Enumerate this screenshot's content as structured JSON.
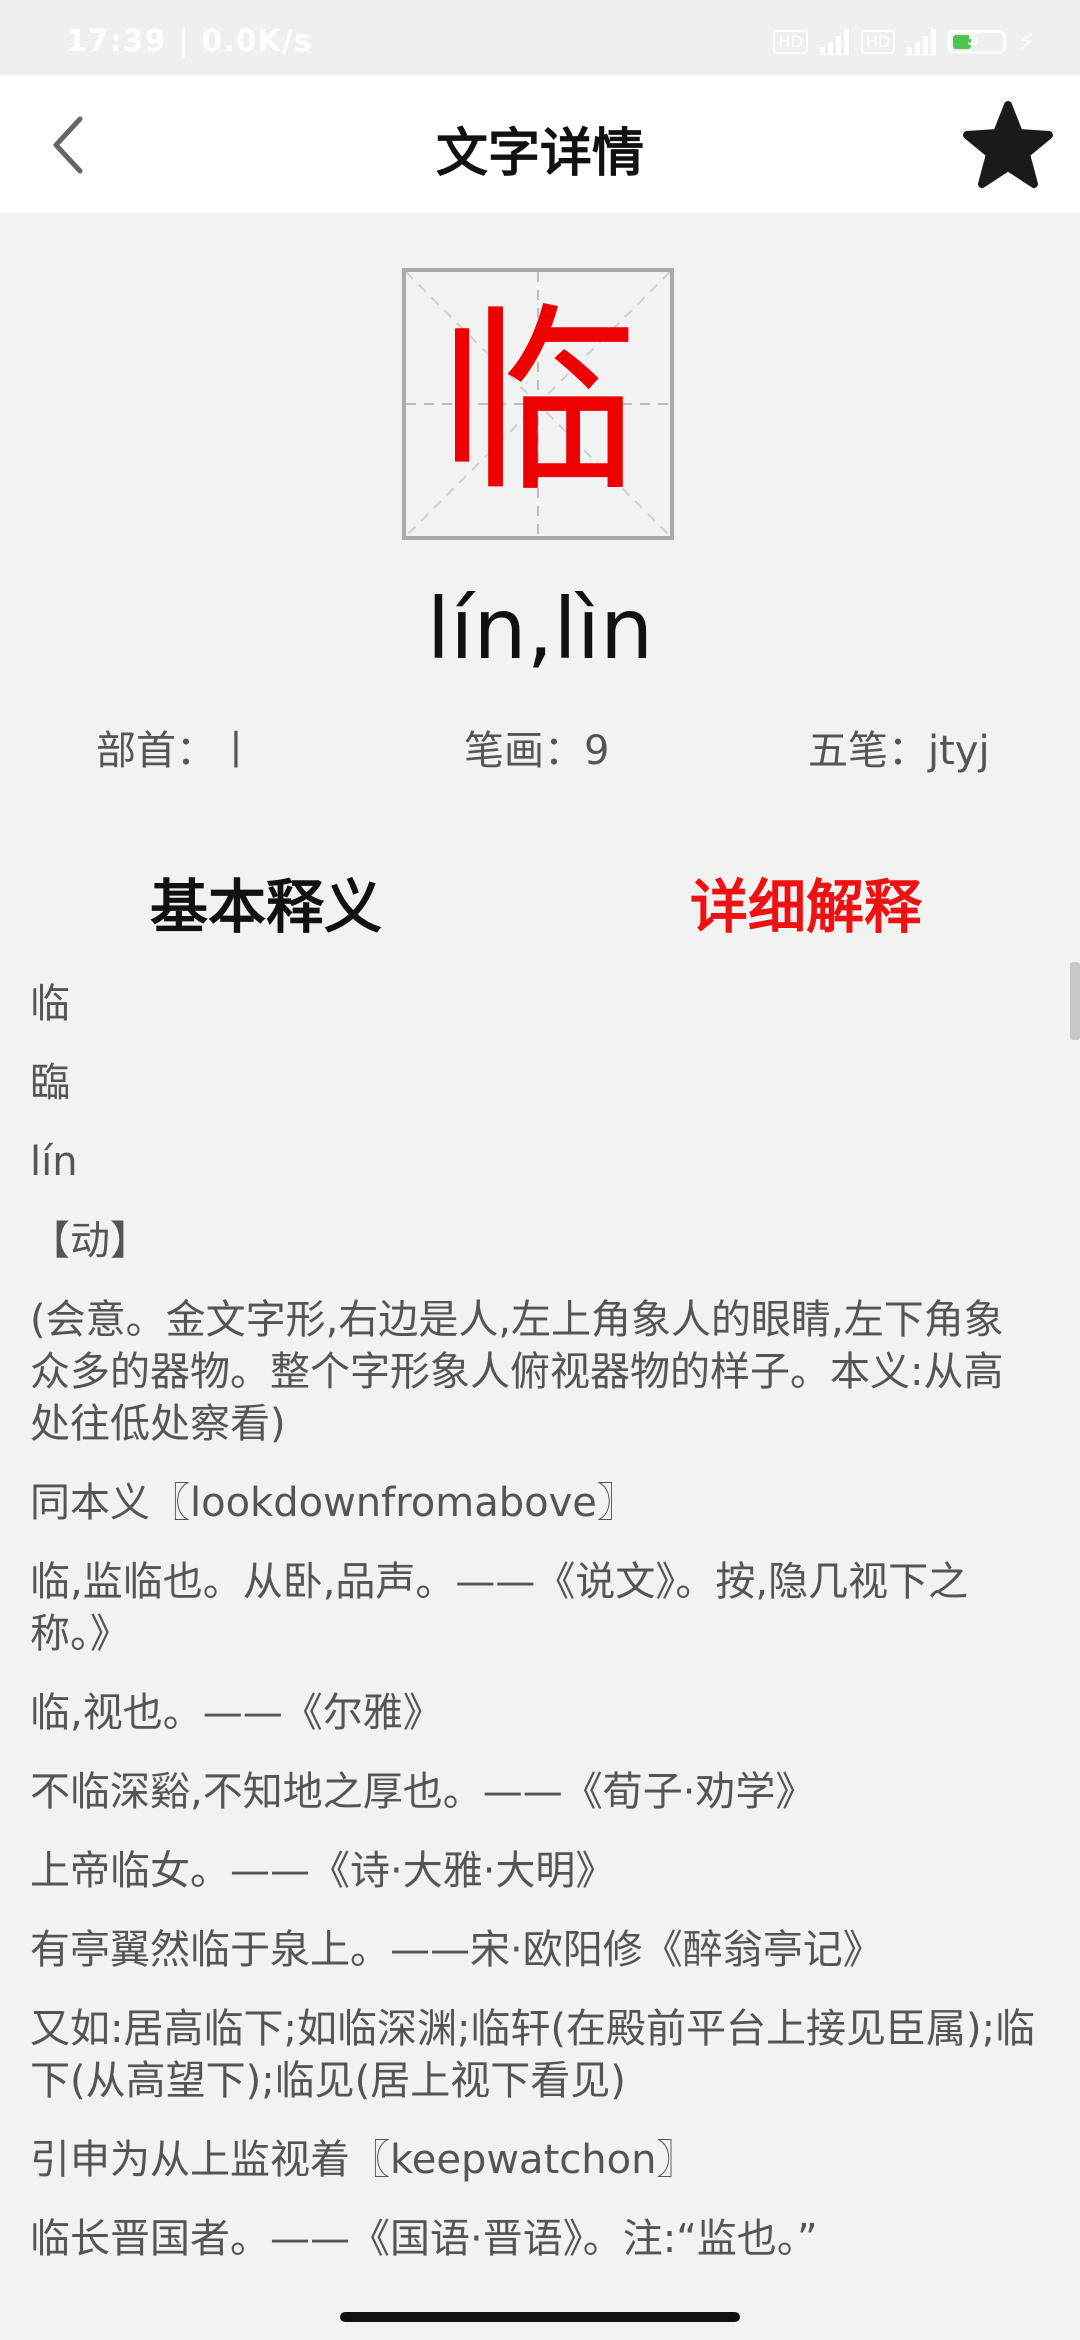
{
  "status_bar": {
    "time_speed": "17:39 | 0.0K/s",
    "hd1": "HD",
    "hd2": "HD",
    "battery": "5"
  },
  "header": {
    "title": "文字详情",
    "back_icon": "chevron-left-icon",
    "favorite_icon": "star-icon"
  },
  "character": {
    "glyph": "临",
    "color": "#ee0000",
    "pinyin": "lín,lìn"
  },
  "meta": {
    "radical": "部首：丨",
    "strokes": "笔画：9",
    "wubi": "五笔：jtyj"
  },
  "tabs": {
    "basic": "基本释义",
    "detail": "详细解释",
    "active_color": "#ee1111"
  },
  "content": [
    "临",
    "臨",
    "lín",
    "【动】",
    "(会意。金文字形,右边是人,左上角象人的眼睛,左下角象众多的器物。整个字形象人俯视器物的样子。本义:从高处往低处察看)",
    "同本义〖lookdownfromabove〗",
    "临,监临也。从卧,品声。——《说文》。按,隐几视下之称。》",
    "临,视也。——《尔雅》",
    "不临深谿,不知地之厚也。——《荀子·劝学》",
    "上帝临女。——《诗·大雅·大明》",
    "有亭翼然临于泉上。——宋·欧阳修《醉翁亭记》",
    "又如:居高临下;如临深渊;临轩(在殿前平台上接见臣属);临下(从高望下);临见(居上视下看见)",
    "引申为从上监视着〖keepwatchon〗",
    "临长晋国者。——《国语·晋语》。注:“监也。”"
  ]
}
